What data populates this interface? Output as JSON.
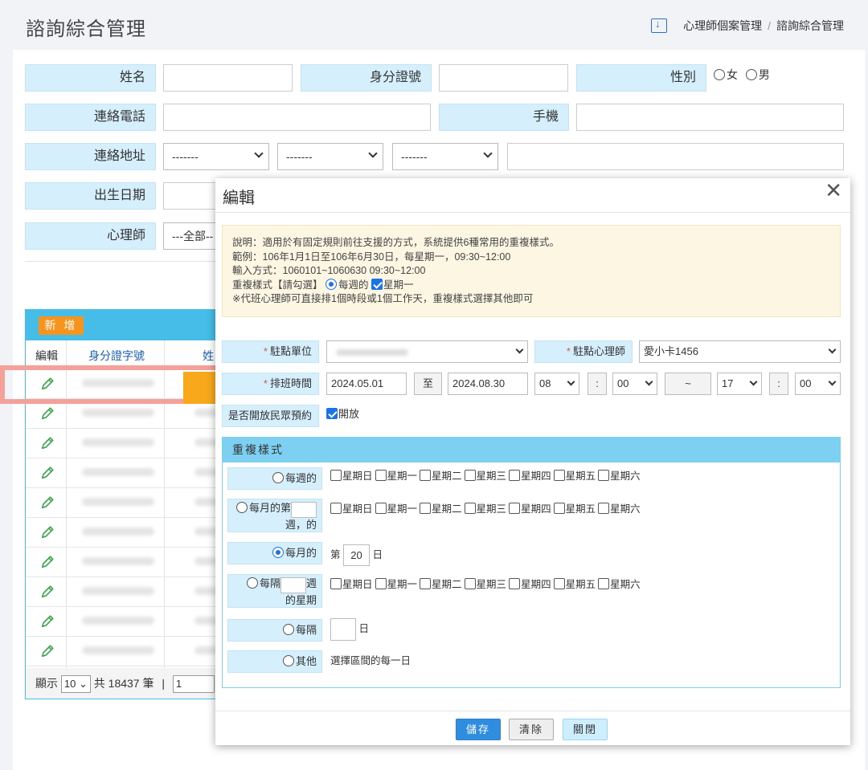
{
  "header": {
    "title": "諮詢綜合管理",
    "breadcrumb": [
      "心理師個案管理",
      "諮詢綜合管理"
    ],
    "breadcrumb_sep": "/"
  },
  "search": {
    "name_label": "姓名",
    "id_label": "身分證號",
    "gender_label": "性別",
    "gender_options": [
      "女",
      "男"
    ],
    "phone_label": "連絡電話",
    "mobile_label": "手機",
    "address_label": "連絡地址",
    "address_selects": [
      "-------",
      "-------",
      "-------"
    ],
    "birth_label": "出生日期",
    "psych_label": "心理師",
    "psych_value": "---全部--"
  },
  "list": {
    "add_label": "新 增",
    "col_edit": "編輯",
    "col_id": "身分證字號",
    "col_name": "姓",
    "pager_show": "顯示",
    "page_size": "10",
    "total_text": "共 18437 筆",
    "pager_sep": "|",
    "page_num": "1",
    "row_count": 10
  },
  "modal": {
    "title": "編輯",
    "close": "✕",
    "note_lines": [
      "說明：適用於有固定規則前往支援的方式，系統提供6種常用的重複樣式。",
      "範例：106年1月1日至106年6月30日，每星期一，09:30~12:00",
      "輸入方式：1060101~1060630 09:30~12:00"
    ],
    "note_line4_prefix": "重複樣式【請勾選】",
    "note_line4_radio": "每週的",
    "note_line4_check": "星期一",
    "note_line5": "※代班心理師可直接排1個時段或1個工作天，重複樣式選擇其他即可",
    "site_label": "駐點單位",
    "site_psych_label": "駐點心理師",
    "site_psych_value": "愛小卡1456",
    "schedule_label": "排班時間",
    "date_from": "2024.05.01",
    "to_label": "至",
    "date_to": "2024.08.30",
    "hour_from": "08",
    "colon": ":",
    "min_from": "00",
    "tilde": "~",
    "hour_to": "17",
    "min_to": "00",
    "public_label": "是否開放民眾預約",
    "public_check": "開放",
    "repeat_title": "重複樣式",
    "weekdays": [
      "星期日",
      "星期一",
      "星期二",
      "星期三",
      "星期四",
      "星期五",
      "星期六"
    ],
    "opt_weekly": "每週的",
    "opt_monthly_week_a": "每月的第",
    "opt_monthly_week_b": "週，的",
    "opt_monthly_day": "每月的",
    "day_prefix": "第",
    "day_value": "20",
    "day_suffix": "日",
    "opt_every_week_a": "每隔",
    "opt_every_week_b": "週",
    "opt_every_week_c": "的星期",
    "opt_every_day": "每隔",
    "every_day_suffix": "日",
    "opt_other": "其他",
    "other_desc": "選擇區間的每一日",
    "btn_save": "儲存",
    "btn_clear": "清除",
    "btn_close": "關閉"
  },
  "colors": {
    "accent": "#45bde8",
    "label_bg": "#d6effc",
    "add_button": "#f7941d",
    "highlight_arrow": "#f7a81b",
    "highlight_box": "#f4a09b",
    "save_button": "#2f8de0"
  }
}
